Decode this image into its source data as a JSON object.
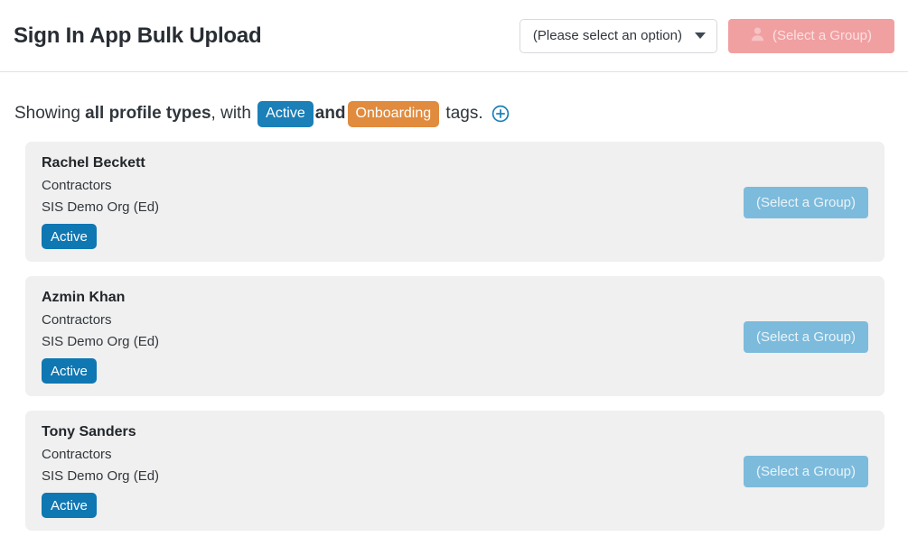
{
  "header": {
    "title": "Sign In App Bulk Upload",
    "profile_select": {
      "value": "(Please select an option)",
      "icon": "chevron-down-icon"
    },
    "group_button": {
      "label": "(Select a Group)",
      "icon": "person-icon",
      "background_color": "#f1a0a2",
      "text_color": "#fbe1e1",
      "disabled": true
    }
  },
  "filter": {
    "prefix": "Showing ",
    "profile_types": "all profile types",
    "with_text": ", with ",
    "tags": [
      {
        "label": "Active",
        "color": "#1b7fb8"
      },
      {
        "label": "Onboarding",
        "color": "#e08b3e"
      }
    ],
    "conjunction": "and",
    "suffix": " tags.",
    "add_tag_icon": "circle-plus-icon",
    "add_tag_color": "#1b7fb8"
  },
  "cards": [
    {
      "name": "Rachel Beckett",
      "group": "Contractors",
      "organisation": "SIS Demo Org (Ed)",
      "status": "Active",
      "status_color": "#0f77b2",
      "action_label": "(Select a Group)"
    },
    {
      "name": "Azmin Khan",
      "group": "Contractors",
      "organisation": "SIS Demo Org (Ed)",
      "status": "Active",
      "status_color": "#0f77b2",
      "action_label": "(Select a Group)"
    },
    {
      "name": "Tony Sanders",
      "group": "Contractors",
      "organisation": "SIS Demo Org (Ed)",
      "status": "Active",
      "status_color": "#0f77b2",
      "action_label": "(Select a Group)"
    }
  ]
}
